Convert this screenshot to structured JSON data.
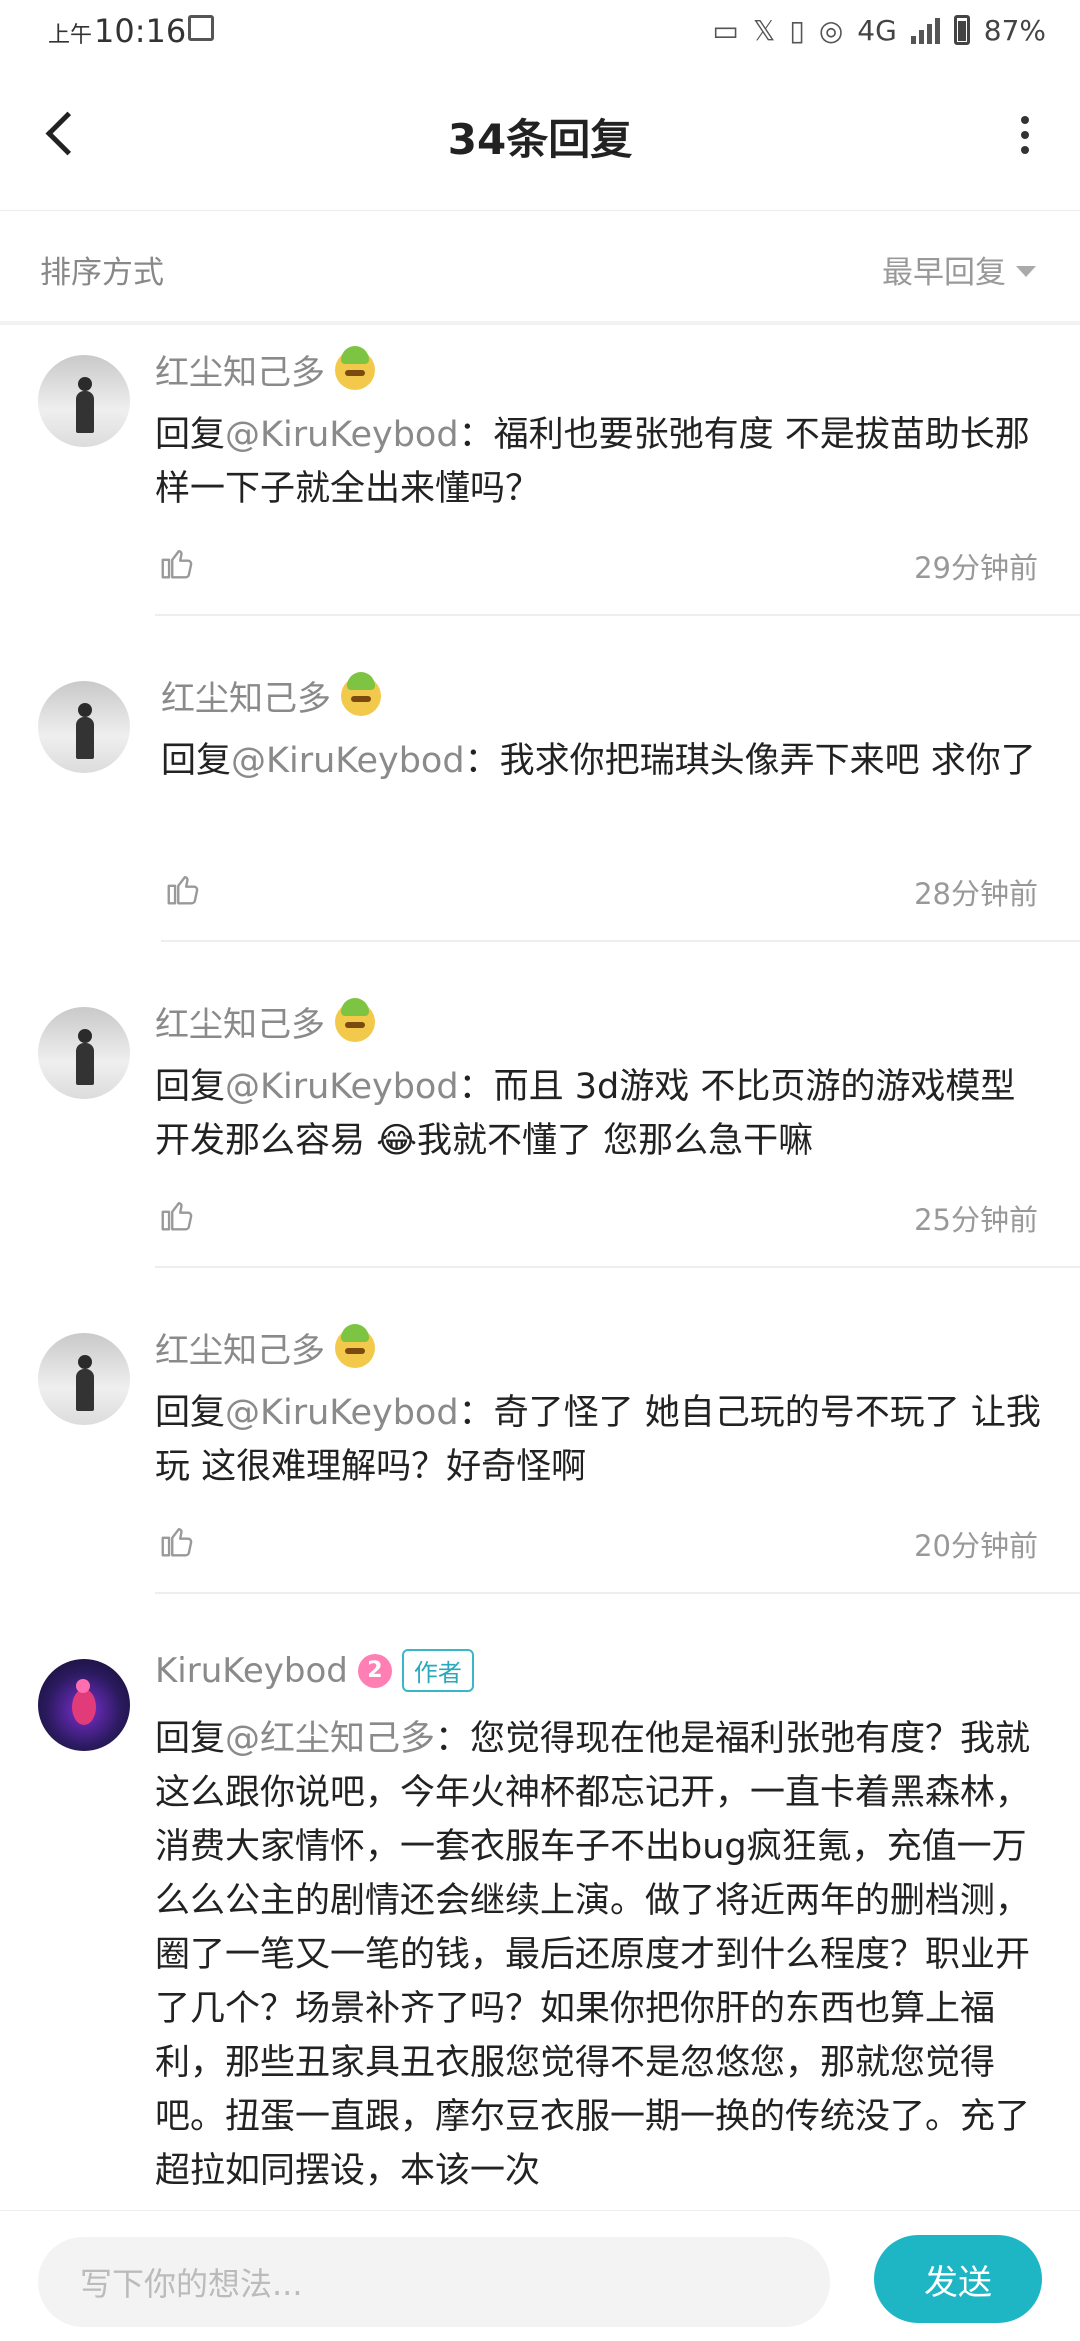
{
  "status_bar": {
    "time_prefix": "上午",
    "time": "10:16",
    "network": "4G",
    "battery": "87%"
  },
  "header": {
    "title": "34条回复"
  },
  "sort": {
    "label": "排序方式",
    "value": "最早回复"
  },
  "comments": [
    {
      "user": "红尘知己多",
      "reply_prefix": "回复",
      "at": "@KiruKeybod",
      "body": "：福利也要张弛有度 不是拔苗助长那样一下子就全出来懂吗？",
      "time": "29分钟前"
    },
    {
      "user": "红尘知己多",
      "reply_prefix": "回复",
      "at": "@KiruKeybod",
      "body": "：我求你把瑞琪头像弄下来吧 求你了",
      "time": "28分钟前"
    },
    {
      "user": "红尘知己多",
      "reply_prefix": "回复",
      "at": "@KiruKeybod",
      "body": "：而且 3d游戏 不比页游的游戏模型开发那么容易 😂我就不懂了 您那么急干嘛",
      "time": "25分钟前"
    },
    {
      "user": "红尘知己多",
      "reply_prefix": "回复",
      "at": "@KiruKeybod",
      "body": "：奇了怪了 她自己玩的号不玩了 让我玩 这很难理解吗？好奇怪啊",
      "time": "20分钟前"
    },
    {
      "user": "KiruKeybod",
      "level": "2",
      "tag": "作者",
      "reply_prefix": "回复",
      "at": "@红尘知己多",
      "body": "：您觉得现在他是福利张弛有度？我就这么跟你说吧，今年火神杯都忘记开，一直卡着黑森林，消费大家情怀，一套衣服车子不出bug疯狂氪，充值一万么么公主的剧情还会继续上演。做了将近两年的删档测，圈了一笔又一笔的钱，最后还原度才到什么程度？职业开了几个？场景补齐了吗？如果你把你肝的东西也算上福利，那些丑家具丑衣服您觉得不是忽悠您，那就您觉得吧。扭蛋一直跟，摩尔豆衣服一期一换的传统没了。充了超拉如同摆设，本该一次"
    }
  ],
  "composer": {
    "placeholder": "写下你的想法...",
    "send_label": "发送"
  }
}
